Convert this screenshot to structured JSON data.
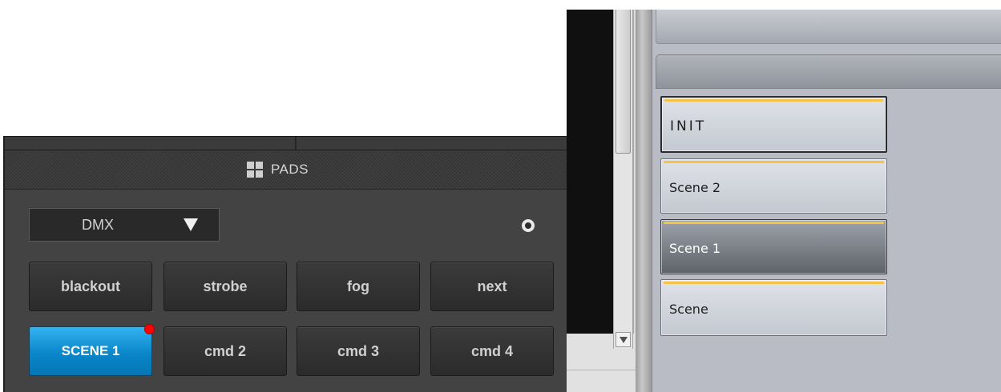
{
  "pads": {
    "title": "PADS",
    "select": {
      "value": "DMX"
    },
    "row1": [
      "blackout",
      "strobe",
      "fog",
      "next"
    ],
    "row2": [
      "SCENE 1",
      "cmd 2",
      "cmd 3",
      "cmd 4"
    ],
    "active_pad": "SCENE 1",
    "colors": {
      "active": "#0a86c9",
      "indicator": "#ff0000"
    }
  },
  "scenes": {
    "items": [
      "INIT",
      "Scene 2",
      "Scene 1",
      "Scene"
    ],
    "accent_color": "#f6c445"
  },
  "icons": {
    "header": "grid-icon",
    "dropdown": "triangle-down-icon",
    "scroll_down": "scroll-down-arrow-icon"
  }
}
